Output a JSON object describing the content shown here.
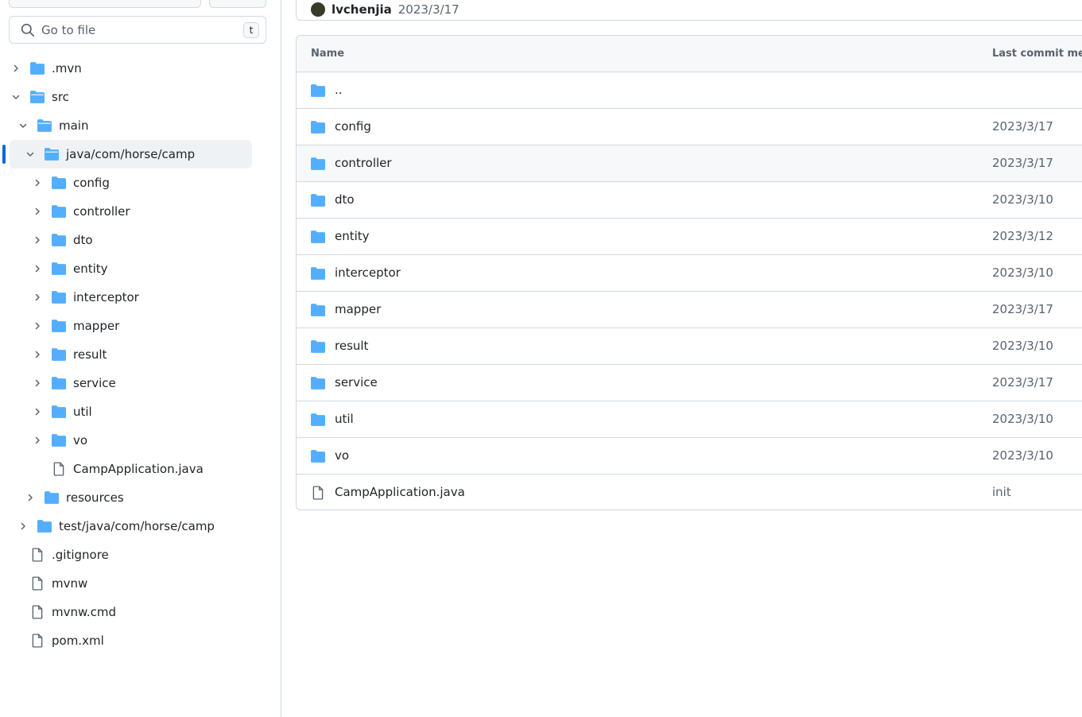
{
  "search": {
    "placeholder": "Go to file",
    "shortcut": "t"
  },
  "commit": {
    "author": "lvchenjia",
    "date": "2023/3/17"
  },
  "tree": [
    {
      "label": ".mvn",
      "depth": 0,
      "type": "folder",
      "expanded": false
    },
    {
      "label": "src",
      "depth": 0,
      "type": "folder",
      "expanded": true
    },
    {
      "label": "main",
      "depth": 1,
      "type": "folder",
      "expanded": true
    },
    {
      "label": "java/com/horse/camp",
      "depth": 2,
      "type": "folder",
      "expanded": true,
      "selected": true
    },
    {
      "label": "config",
      "depth": 3,
      "type": "folder",
      "expanded": false
    },
    {
      "label": "controller",
      "depth": 3,
      "type": "folder",
      "expanded": false
    },
    {
      "label": "dto",
      "depth": 3,
      "type": "folder",
      "expanded": false
    },
    {
      "label": "entity",
      "depth": 3,
      "type": "folder",
      "expanded": false
    },
    {
      "label": "interceptor",
      "depth": 3,
      "type": "folder",
      "expanded": false
    },
    {
      "label": "mapper",
      "depth": 3,
      "type": "folder",
      "expanded": false
    },
    {
      "label": "result",
      "depth": 3,
      "type": "folder",
      "expanded": false
    },
    {
      "label": "service",
      "depth": 3,
      "type": "folder",
      "expanded": false
    },
    {
      "label": "util",
      "depth": 3,
      "type": "folder",
      "expanded": false
    },
    {
      "label": "vo",
      "depth": 3,
      "type": "folder",
      "expanded": false
    },
    {
      "label": "CampApplication.java",
      "depth": 3,
      "type": "file"
    },
    {
      "label": "resources",
      "depth": 2,
      "type": "folder",
      "expanded": false
    },
    {
      "label": "test/java/com/horse/camp",
      "depth": 1,
      "type": "folder",
      "expanded": false
    },
    {
      "label": ".gitignore",
      "depth": 0,
      "type": "file"
    },
    {
      "label": "mvnw",
      "depth": 0,
      "type": "file"
    },
    {
      "label": "mvnw.cmd",
      "depth": 0,
      "type": "file"
    },
    {
      "label": "pom.xml",
      "depth": 0,
      "type": "file"
    }
  ],
  "table": {
    "headers": {
      "name": "Name",
      "message": "Last commit mes"
    },
    "rows": [
      {
        "name": "..",
        "type": "folder",
        "info": ""
      },
      {
        "name": "config",
        "type": "folder",
        "info": "2023/3/17"
      },
      {
        "name": "controller",
        "type": "folder",
        "info": "2023/3/17"
      },
      {
        "name": "dto",
        "type": "folder",
        "info": "2023/3/10"
      },
      {
        "name": "entity",
        "type": "folder",
        "info": "2023/3/12"
      },
      {
        "name": "interceptor",
        "type": "folder",
        "info": "2023/3/10"
      },
      {
        "name": "mapper",
        "type": "folder",
        "info": "2023/3/17"
      },
      {
        "name": "result",
        "type": "folder",
        "info": "2023/3/10"
      },
      {
        "name": "service",
        "type": "folder",
        "info": "2023/3/17"
      },
      {
        "name": "util",
        "type": "folder",
        "info": "2023/3/10"
      },
      {
        "name": "vo",
        "type": "folder",
        "info": "2023/3/10"
      },
      {
        "name": "CampApplication.java",
        "type": "file",
        "info": "init"
      }
    ]
  },
  "colors": {
    "folder": "#54aeff",
    "accent": "#0969da",
    "muted": "#59636e",
    "border": "#d1d9e0"
  }
}
